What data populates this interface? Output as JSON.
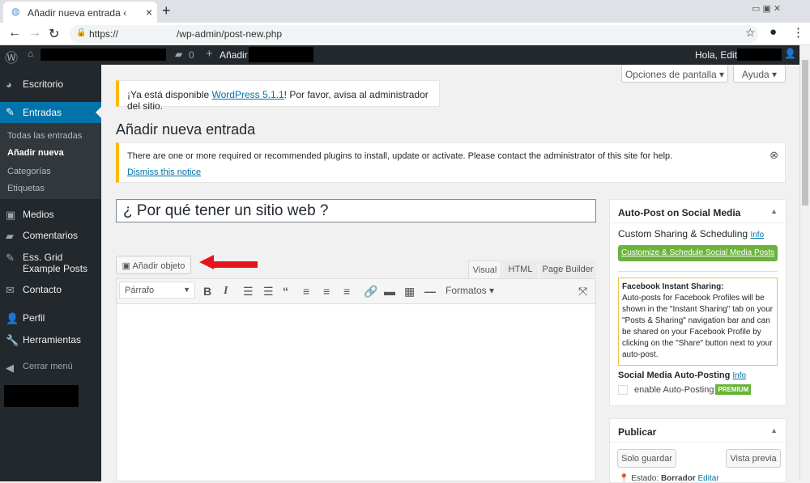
{
  "browser": {
    "tab_title": "Añadir nueva entrada ‹",
    "url_prefix": "https://",
    "url_path": "/wp-admin/post-new.php"
  },
  "adminbar": {
    "comments": "0",
    "add": "Añadir",
    "greeting": "Hola, Editor"
  },
  "sidebar": {
    "items": [
      "Escritorio",
      "Entradas",
      "Medios",
      "Comentarios",
      "Ess. Grid Example Posts",
      "Contacto",
      "Perfil",
      "Herramientas",
      "Cerrar menú"
    ],
    "sub": [
      "Todas las entradas",
      "Añadir nueva",
      "Categorías",
      "Etiquetas"
    ]
  },
  "top": {
    "screen_options": "Opciones de pantalla",
    "help": "Ayuda"
  },
  "update_notice": {
    "pre": "¡Ya está disponible ",
    "link": "WordPress 5.1.1",
    "post": "! Por favor, avisa al administrador del sitio."
  },
  "page_title": "Añadir nueva entrada",
  "plugin_notice": {
    "text": "There are one or more required or recommended plugins to install, update or activate. Please contact the administrator of this site for help.",
    "dismiss": "Dismiss this notice"
  },
  "post_title": "¿ Por qué tener un sitio web ?",
  "editor": {
    "add_media": "Añadir objeto",
    "tabs": [
      "Visual",
      "HTML",
      "Page Builder"
    ],
    "format": "Párrafo",
    "formats": "Formatos"
  },
  "autopost": {
    "title": "Auto-Post on Social Media",
    "custom": "Custom Sharing & Scheduling",
    "info": "Info",
    "button": "Customize & Schedule Social Media Posts",
    "fb_title": "Facebook Instant Sharing:",
    "fb_text": "Auto-posts for Facebook Profiles will be shown in the \"Instant Sharing\" tab on your \"Posts & Sharing\" navigation bar and can be shared on your Facebook Profile by clicking on the \"Share\" button next to your auto-post.",
    "auto_title": "Social Media Auto-Posting",
    "enable": "enable Auto-Posting",
    "premium": "PREMIUM"
  },
  "publish": {
    "title": "Publicar",
    "save": "Solo guardar",
    "preview": "Vista previa",
    "status_label": "Estado:",
    "status": "Borrador",
    "edit": "Editar"
  }
}
